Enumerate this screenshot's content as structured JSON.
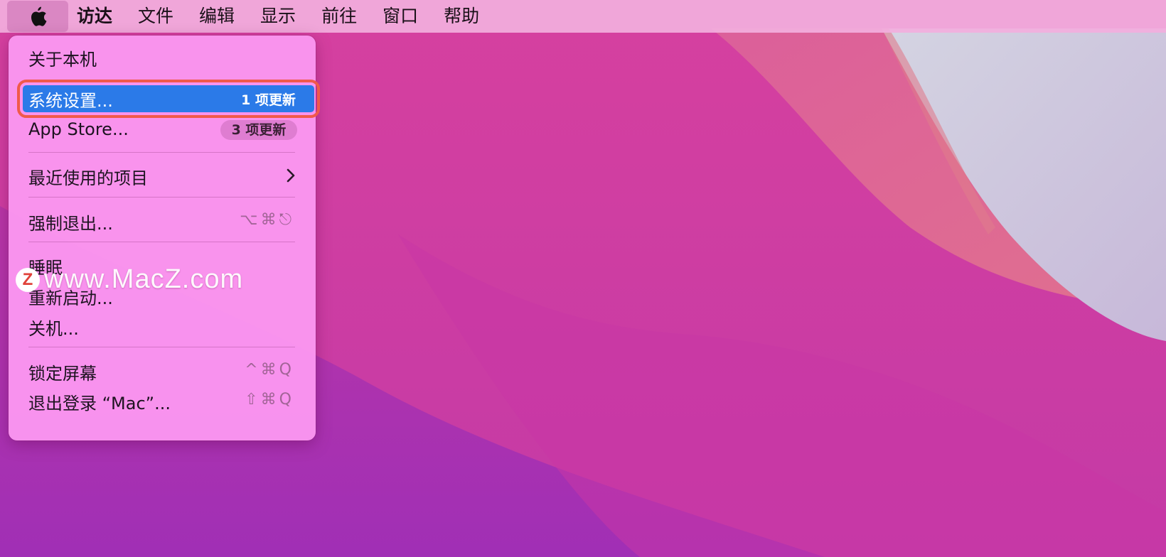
{
  "colors": {
    "highlight": "#2b7ae8",
    "callout_box": "#f05a4a",
    "menubar": "#f2aede"
  },
  "menubar": {
    "apple_icon": "apple-icon",
    "app_name": "访达",
    "items": [
      "文件",
      "编辑",
      "显示",
      "前往",
      "窗口",
      "帮助"
    ]
  },
  "menu": {
    "about": "关于本机",
    "system_settings": {
      "label": "系统设置...",
      "badge": "1 项更新"
    },
    "app_store": {
      "label": "App Store...",
      "badge": "3 项更新"
    },
    "recent_items": {
      "label": "最近使用的项目",
      "icon": "chevron-right-icon"
    },
    "force_quit": {
      "label": "强制退出...",
      "shortcut": "⌥⌘⎋"
    },
    "sleep": "睡眠",
    "restart": "重新启动...",
    "shutdown": "关机...",
    "lock_screen": {
      "label": "锁定屏幕",
      "shortcut": "^⌘Q"
    },
    "log_out": {
      "label": "退出登录 “Mac”...",
      "shortcut": "⇧⌘Q"
    }
  },
  "watermark": {
    "logo": "Z",
    "text": "www.MacZ.com"
  }
}
